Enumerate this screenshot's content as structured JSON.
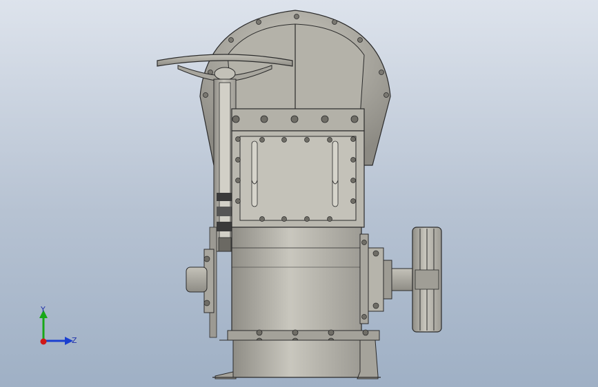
{
  "triad": {
    "x_label": "",
    "y_label": "Y",
    "z_label": "Z",
    "colors": {
      "x": "#d01818",
      "y": "#18a818",
      "z": "#1a3fd0"
    }
  },
  "scene": {
    "background_top": "#dde3ec",
    "background_bottom": "#9fb0c5",
    "metal_color": "#b9b7ae",
    "edge_color": "#2a2a2a"
  }
}
